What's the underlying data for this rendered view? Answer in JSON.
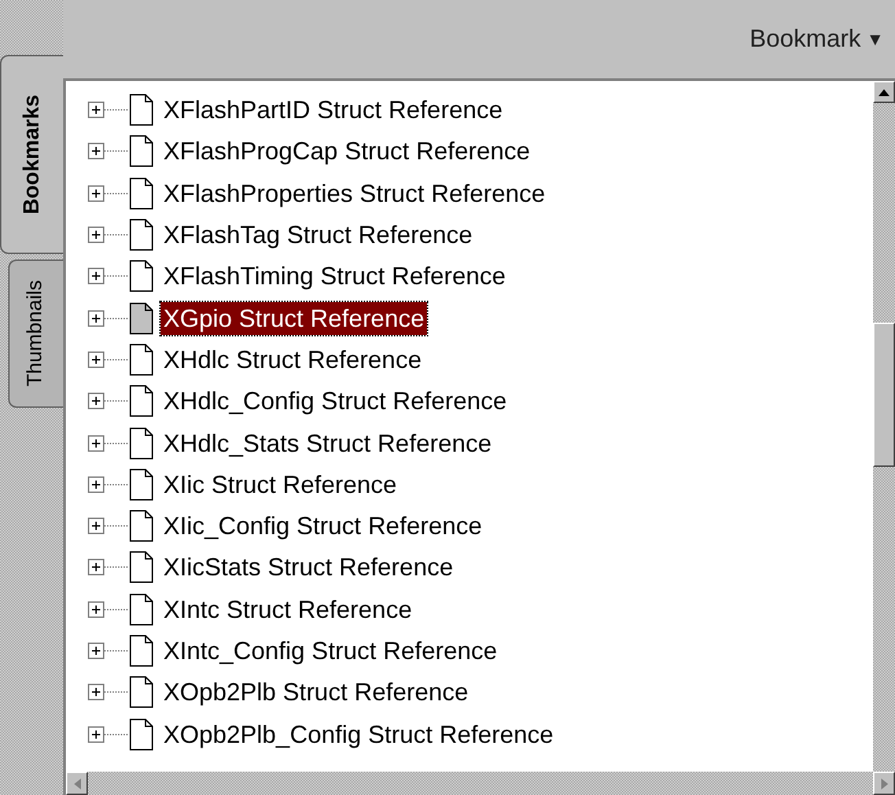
{
  "tabs": [
    {
      "label": "Bookmarks",
      "selected": true
    },
    {
      "label": "Thumbnails",
      "selected": false
    }
  ],
  "menu_button": {
    "label": "Bookmark",
    "caret": "▼"
  },
  "bookmarks": [
    {
      "label": "XFlashPartID Struct Reference",
      "selected": false,
      "expanded": false
    },
    {
      "label": "XFlashProgCap Struct Reference",
      "selected": false,
      "expanded": false
    },
    {
      "label": "XFlashProperties Struct Reference",
      "selected": false,
      "expanded": false
    },
    {
      "label": "XFlashTag Struct Reference",
      "selected": false,
      "expanded": false
    },
    {
      "label": "XFlashTiming Struct Reference",
      "selected": false,
      "expanded": false
    },
    {
      "label": "XGpio Struct Reference",
      "selected": true,
      "expanded": false
    },
    {
      "label": "XHdlc Struct Reference",
      "selected": false,
      "expanded": false
    },
    {
      "label": "XHdlc_Config Struct Reference",
      "selected": false,
      "expanded": false
    },
    {
      "label": "XHdlc_Stats Struct Reference",
      "selected": false,
      "expanded": false
    },
    {
      "label": "XIic Struct Reference",
      "selected": false,
      "expanded": false
    },
    {
      "label": "XIic_Config Struct Reference",
      "selected": false,
      "expanded": false
    },
    {
      "label": "XIicStats Struct Reference",
      "selected": false,
      "expanded": false
    },
    {
      "label": "XIntc Struct Reference",
      "selected": false,
      "expanded": false
    },
    {
      "label": "XIntc_Config Struct Reference",
      "selected": false,
      "expanded": false
    },
    {
      "label": "XOpb2Plb Struct Reference",
      "selected": false,
      "expanded": false
    },
    {
      "label": "XOpb2Plb_Config Struct Reference",
      "selected": false,
      "expanded": false
    }
  ]
}
